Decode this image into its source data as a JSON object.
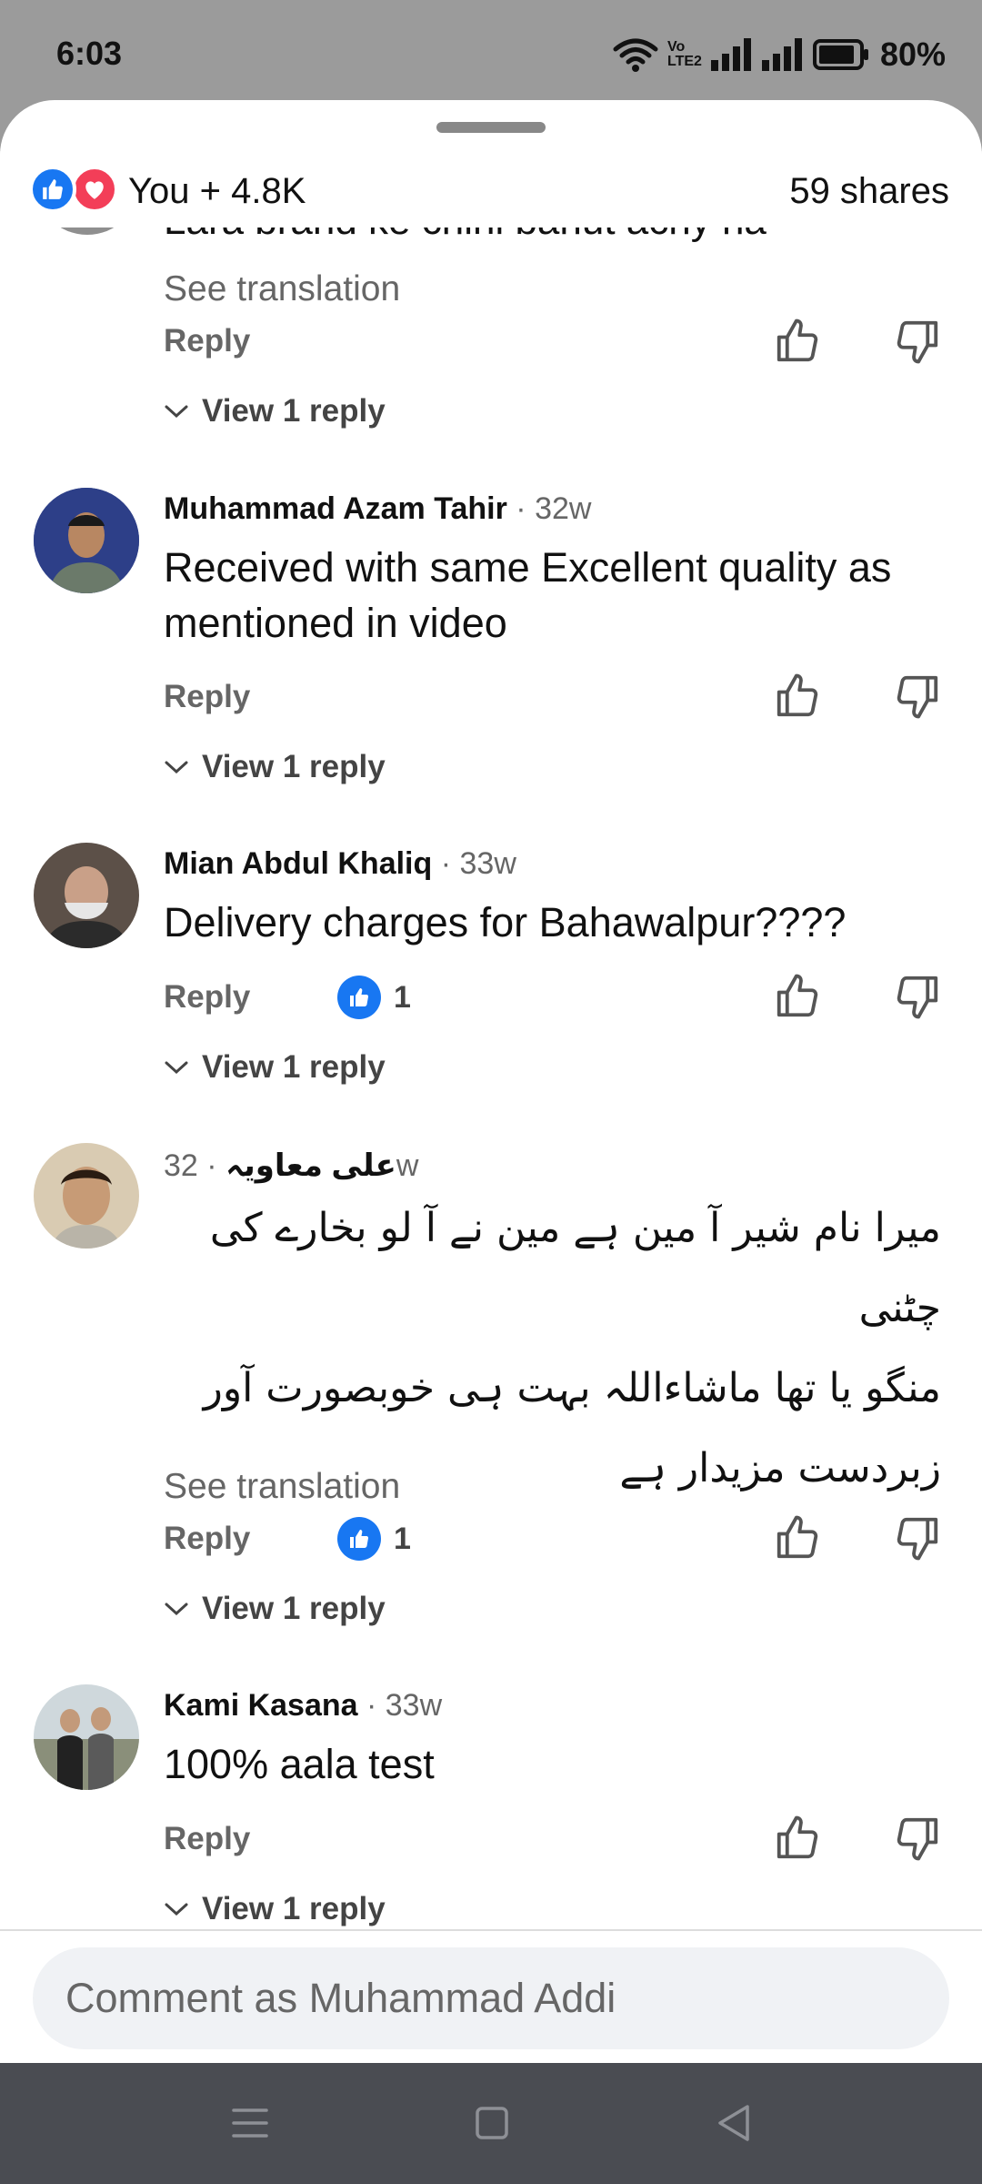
{
  "status_bar": {
    "time": "6:03",
    "network_label_top": "Vo",
    "network_label_bottom": "LTE2",
    "battery": "80%"
  },
  "header": {
    "reactions_icons": [
      "like-icon",
      "love-icon"
    ],
    "reaction_count": "You + 4.8K",
    "shares": "59 shares"
  },
  "partial_comment": {
    "text": "Lara brand ke chini bahut achy ha",
    "see_translation": "See translation",
    "reply_label": "Reply",
    "view_replies": "View 1 reply"
  },
  "comments": [
    {
      "author": "Muhammad Azam Tahir",
      "age": "· 32w",
      "text": "Received with same Excellent quality as mentioned in video",
      "reply_label": "Reply",
      "view_replies": "View 1 reply"
    },
    {
      "author": "Mian Abdul Khaliq",
      "age": "· 33w",
      "text": "Delivery charges for Bahawalpur????",
      "reply_label": "Reply",
      "like_count": "1",
      "view_replies": "View 1 reply"
    },
    {
      "author": "علی معاویہ",
      "age": "· 32w",
      "text_lines": [
        "میرا نام شیر آ مین ہے مین نے آ لو بخارے کی چٹنی",
        "منگو یا تھا ماشاءاللہ بہت ہی خوبصورت آور",
        "زبردست مزیدار ہے"
      ],
      "see_translation": "See translation",
      "reply_label": "Reply",
      "like_count": "1",
      "view_replies": "View 1 reply"
    },
    {
      "author": "Kami Kasana",
      "age": "· 33w",
      "text": "100% aala test",
      "reply_label": "Reply",
      "view_replies": "View 1 reply"
    }
  ],
  "composer": {
    "placeholder": "Comment as Muhammad Addi"
  },
  "nav_bar": {
    "buttons": [
      "menu-icon",
      "home-square-icon",
      "back-triangle-icon"
    ]
  },
  "colors": {
    "accent": "#1877f2",
    "love": "#f33e58",
    "status_bar_bg": "#9b9b9b",
    "nav_bar_bg": "#4a4c52"
  }
}
